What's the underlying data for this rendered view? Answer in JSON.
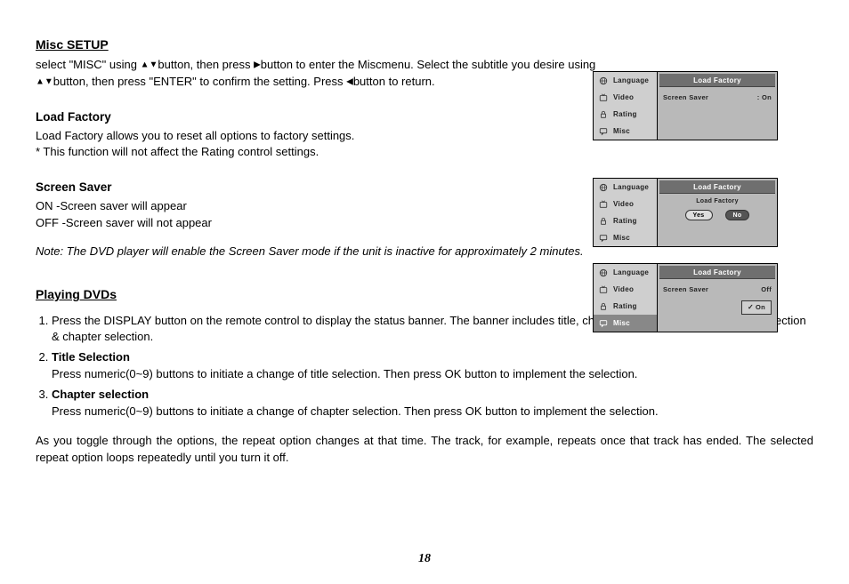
{
  "miscSetup": {
    "heading": "Misc SETUP",
    "intro_a": "select \"MISC\" using ",
    "intro_b": "button, then press ",
    "intro_c": "button to enter the Miscmenu. Select the subtitle you desire using ",
    "intro_d": "button, then press \"ENTER\" to confirm the setting. Press ",
    "intro_e": "button to return."
  },
  "loadFactory": {
    "title": "Load Factory",
    "line1": "Load Factory allows you to reset all options to factory settings.",
    "line2": "* This function will not affect the Rating control settings."
  },
  "screenSaver": {
    "title": "Screen Saver",
    "on": "ON -Screen saver will appear",
    "off": "OFF -Screen saver will not appear"
  },
  "note": "Note: The DVD player will enable the Screen Saver mode if the unit is inactive for approximately 2 minutes.",
  "playing": {
    "heading": "Playing DVDs",
    "item1": "Press the DISPLAY button on the remote control to display the status banner. The banner includes title, chapter, angle, audio, subtitle, title selection & chapter selection.",
    "item2title": "Title Selection",
    "item2body": "Press numeric(0~9) buttons to initiate a change of title selection. Then press OK button to implement the selection.",
    "item3title": "Chapter selection",
    "item3body": "Press numeric(0~9) buttons to initiate a change of chapter selection. Then press OK button to implement the selection.",
    "para": "As you toggle through the options, the repeat option changes at that time. The track, for example, repeats once that track has ended. The selected repeat option loops repeatedly until you turn it off."
  },
  "pageNumber": "18",
  "osd": {
    "menu": {
      "language": "Language",
      "video": "Video",
      "rating": "Rating",
      "misc": "Misc"
    },
    "header": "Load Factory",
    "panel1": {
      "label": "Screen Saver",
      "value": ": On"
    },
    "panel2": {
      "label": "Load Factory",
      "yes": "Yes",
      "no": "No"
    },
    "panel3": {
      "label": "Screen Saver",
      "off": "Off",
      "on": "On"
    }
  }
}
